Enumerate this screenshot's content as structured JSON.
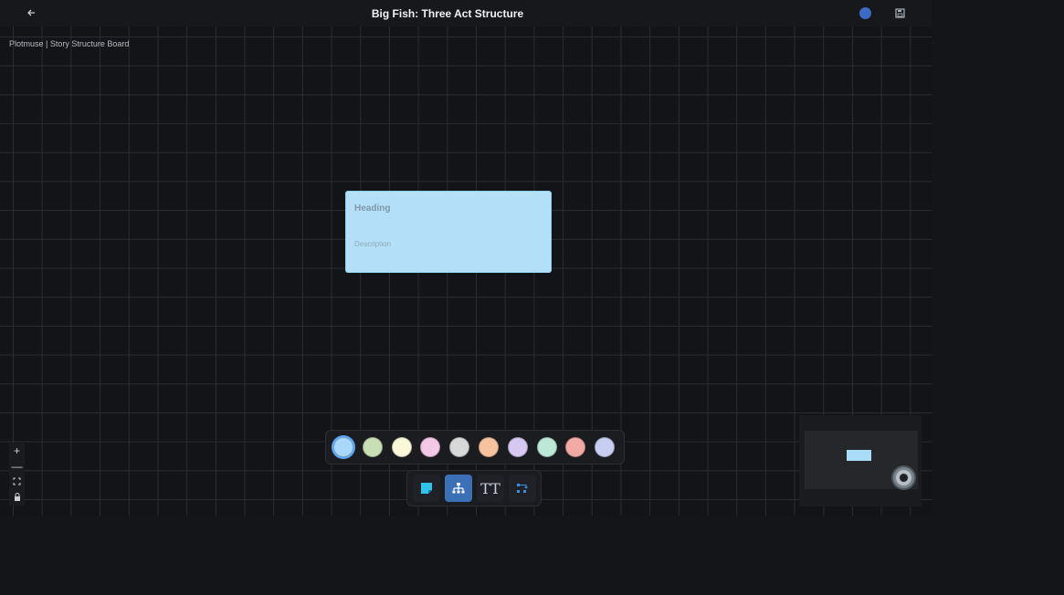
{
  "header": {
    "back_icon": "arrow-left-icon",
    "title": "Big Fish: Three Act Structure",
    "status_color": "#3d6bc4",
    "save_icon": "save-icon"
  },
  "canvas": {
    "board_label": "Plotmuse | Story Structure Board",
    "node": {
      "heading": "Heading",
      "description": "Description",
      "color": "#b3e0f8"
    }
  },
  "zoom_controls": [
    {
      "icon": "plus-icon",
      "label": "+"
    },
    {
      "icon": "minus-icon",
      "label": "—"
    },
    {
      "icon": "fit-view-icon",
      "label": "⛶"
    },
    {
      "icon": "lock-icon",
      "label": "🔒"
    }
  ],
  "palette": {
    "selected_index": 0,
    "colors": [
      "#a9d8fb",
      "#c8dfb5",
      "#fbf7d9",
      "#f3c8e6",
      "#d8d8d8",
      "#f7c39e",
      "#d7c8f1",
      "#bde8d7",
      "#f2aaa5",
      "#c8cdf2"
    ]
  },
  "toolbar": {
    "active_index": 1,
    "tools": [
      {
        "name": "sticky-note-tool",
        "icon": "sticky-note-icon"
      },
      {
        "name": "hierarchy-tool",
        "icon": "hierarchy-icon"
      },
      {
        "name": "text-tool",
        "icon": "text-icon",
        "label": "TT"
      },
      {
        "name": "connector-tool",
        "icon": "connector-icon"
      }
    ]
  },
  "minimap": {
    "node_color": "#a9dcf7"
  }
}
